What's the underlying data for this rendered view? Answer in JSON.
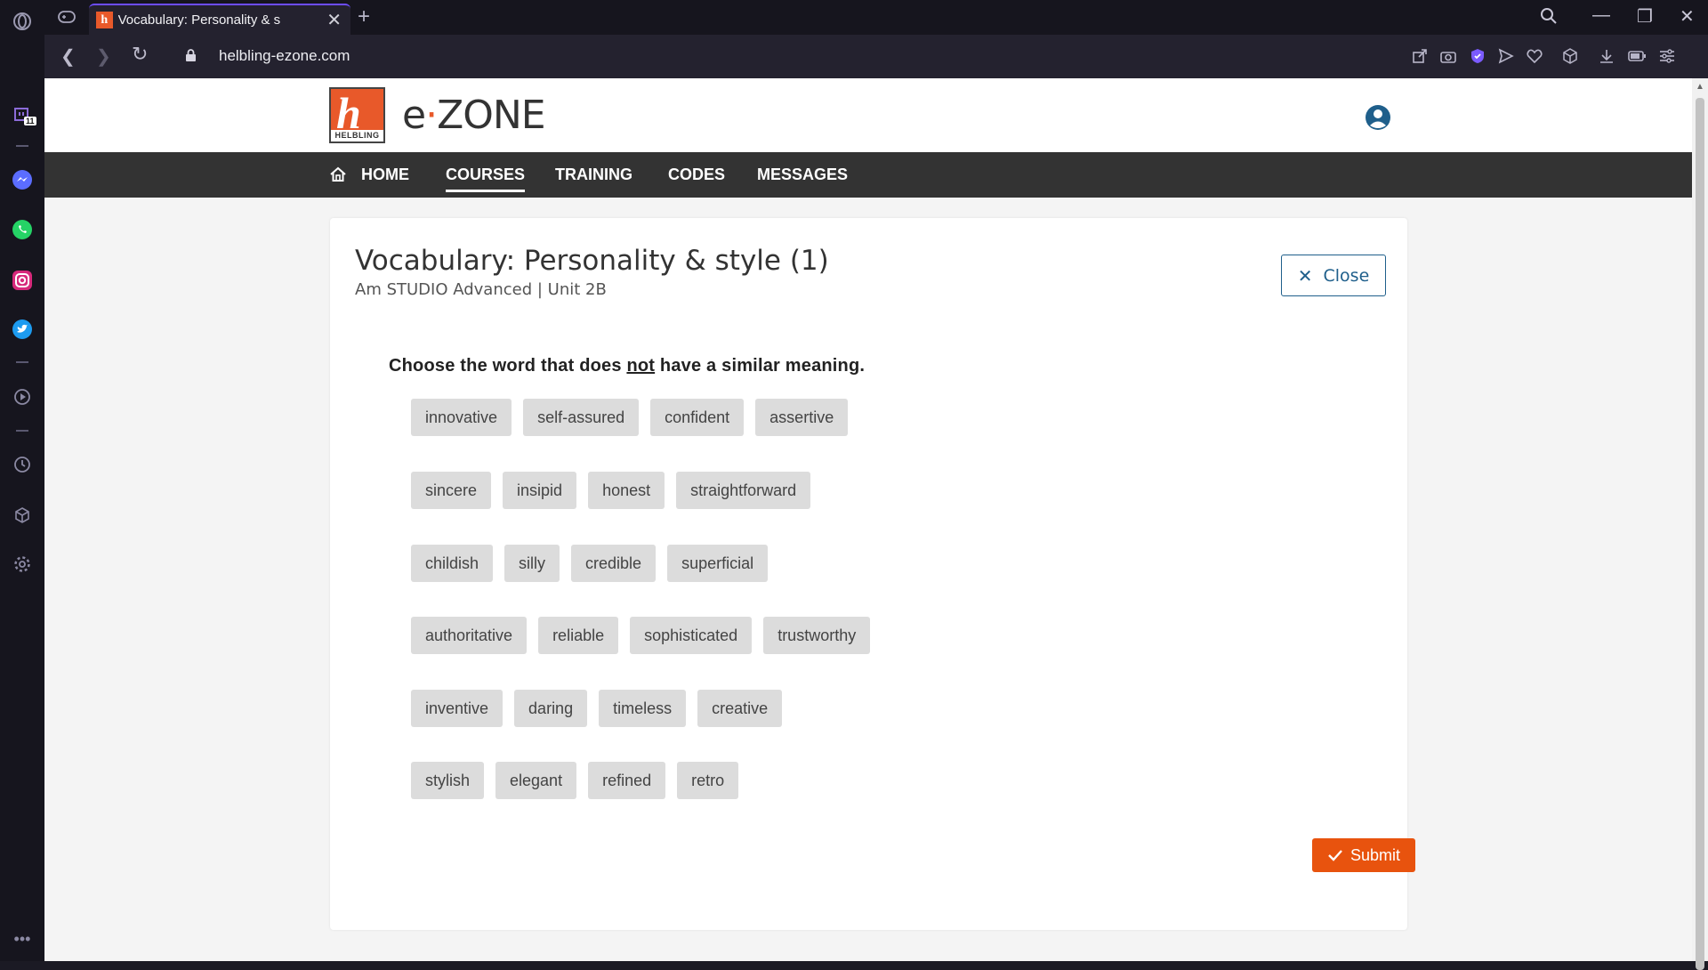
{
  "browser": {
    "tab_title": "Vocabulary: Personality & s",
    "tab_favicon_letter": "h",
    "new_tab_symbol": "+",
    "close_tab_symbol": "✕",
    "url": "helbling-ezone.com",
    "sidebar_badge": "11",
    "window_controls": {
      "minimize": "—",
      "restore": "❐",
      "close": "✕"
    },
    "accent_color": "#6d4dff"
  },
  "site": {
    "logo_letter": "h",
    "logo_tag": "HELBLING",
    "brand_prefix": "e",
    "brand_dot": "·",
    "brand_suffix": "ZONE",
    "brand_color": "#e8592a",
    "nav": {
      "home": "HOME",
      "courses": "COURSES",
      "training": "TRAINING",
      "codes": "CODES",
      "messages": "MESSAGES",
      "active": "courses"
    }
  },
  "exercise": {
    "title": "Vocabulary: Personality & style (1)",
    "subtitle": "Am STUDIO Advanced | Unit 2B",
    "close_label": "Close",
    "instruction_before": "Choose the word that does ",
    "instruction_emphasis": "not",
    "instruction_after": " have a similar meaning.",
    "rows": [
      [
        "innovative",
        "self-assured",
        "confident",
        "assertive"
      ],
      [
        "sincere",
        "insipid",
        "honest",
        "straightforward"
      ],
      [
        "childish",
        "silly",
        "credible",
        "superficial"
      ],
      [
        "authoritative",
        "reliable",
        "sophisticated",
        "trustworthy"
      ],
      [
        "inventive",
        "daring",
        "timeless",
        "creative"
      ],
      [
        "stylish",
        "elegant",
        "refined",
        "retro"
      ]
    ],
    "submit_label": "Submit",
    "submit_color": "#e8530e"
  }
}
